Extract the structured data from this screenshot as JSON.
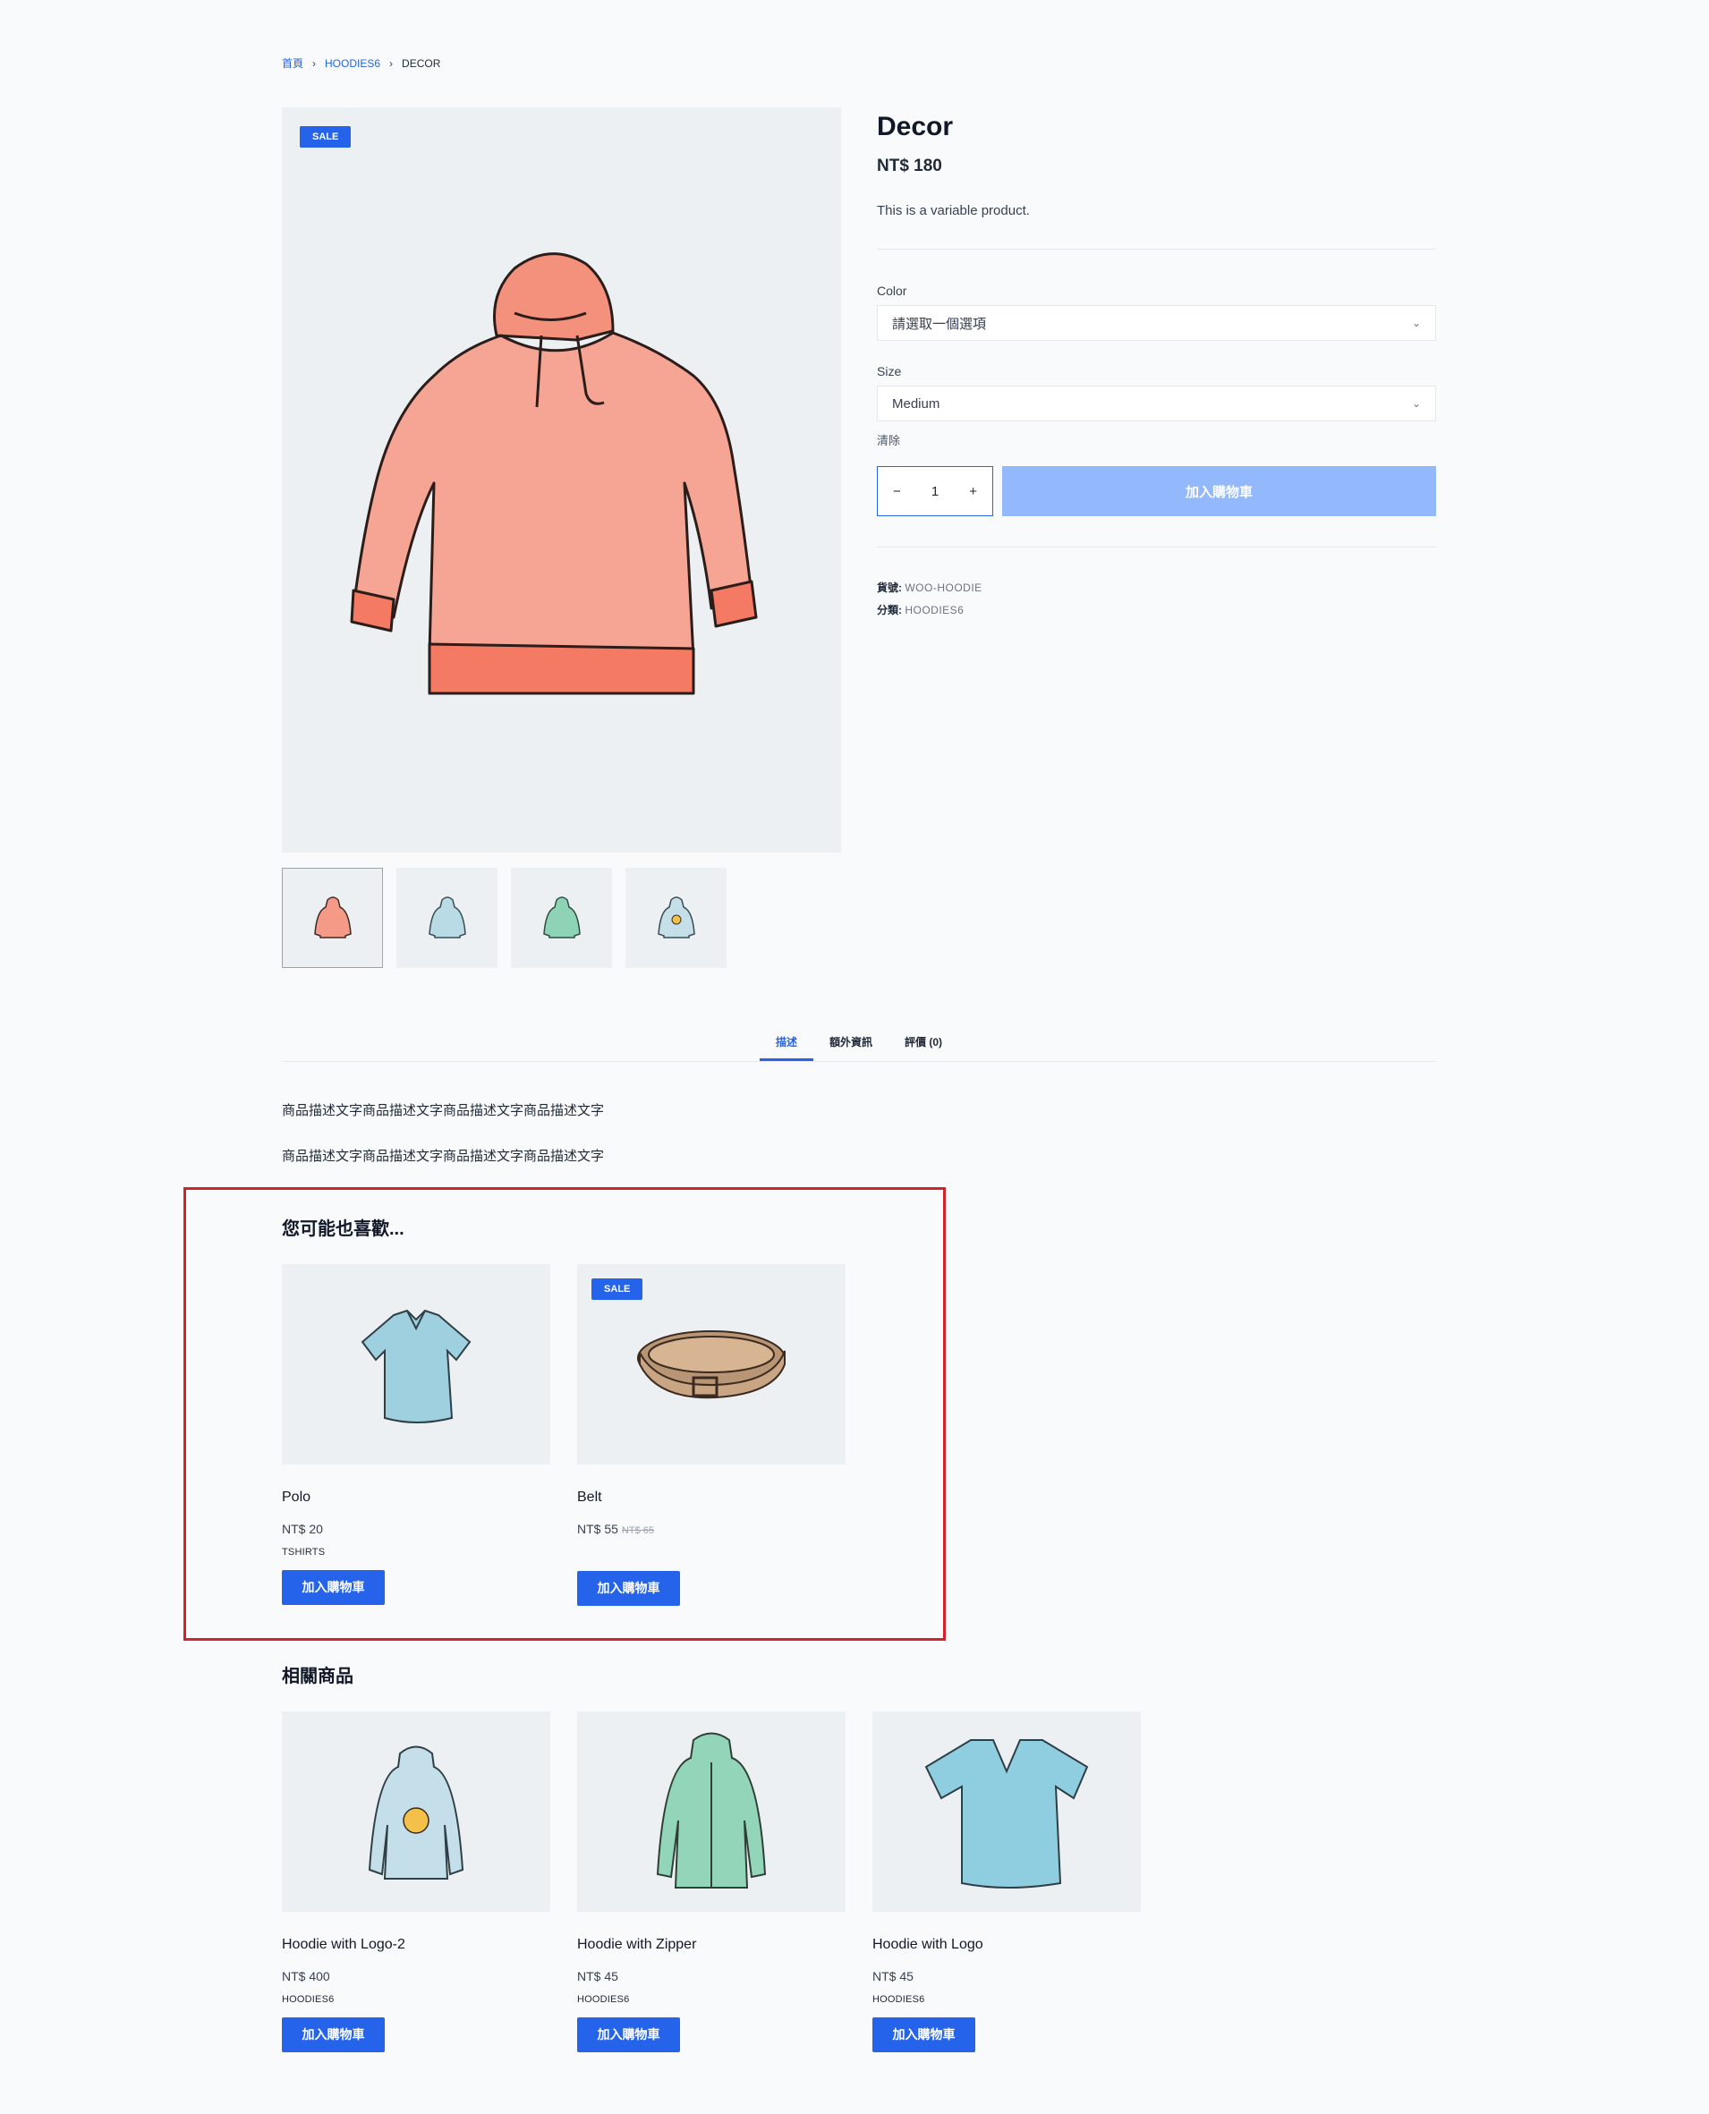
{
  "breadcrumb": {
    "home": "首頁",
    "category": "HOODIES6",
    "current": "DECOR"
  },
  "gallery": {
    "sale_badge": "SALE"
  },
  "product": {
    "title": "Decor",
    "price": "NT$ 180",
    "short_description": "This is a variable product.",
    "color_label": "Color",
    "color_value": "請選取一個選項",
    "size_label": "Size",
    "size_value": "Medium",
    "clear_label": "清除",
    "quantity": "1",
    "qty_minus": "−",
    "qty_plus": "+",
    "add_to_cart": "加入購物車",
    "sku_label": "貨號:",
    "sku_value": "WOO-HOODIE",
    "category_label": "分類:",
    "category_value": "HOODIES6"
  },
  "tabs": {
    "description": "描述",
    "additional": "額外資訊",
    "reviews": "評價 (0)"
  },
  "description": {
    "line1": "商品描述文字商品描述文字商品描述文字商品描述文字",
    "line2": "商品描述文字商品描述文字商品描述文字商品描述文字"
  },
  "upsells": {
    "title": "您可能也喜歡...",
    "items": [
      {
        "name": "Polo",
        "price": "NT$ 20",
        "old_price": "",
        "category": "TSHIRTS",
        "button": "加入購物車",
        "badge": ""
      },
      {
        "name": "Belt",
        "price": "NT$ 55",
        "old_price": "NT$ 65",
        "category": "",
        "button": "加入購物車",
        "badge": "SALE"
      }
    ]
  },
  "related": {
    "title": "相關商品",
    "items": [
      {
        "name": "Hoodie with Logo-2",
        "price": "NT$ 400",
        "category": "HOODIES6",
        "button": "加入購物車"
      },
      {
        "name": "Hoodie with Zipper",
        "price": "NT$ 45",
        "category": "HOODIES6",
        "button": "加入購物車"
      },
      {
        "name": "Hoodie with Logo",
        "price": "NT$ 45",
        "category": "HOODIES6",
        "button": "加入購物車"
      }
    ]
  },
  "colors": {
    "accent": "#2563eb",
    "button_disabled": "#93b8fb",
    "highlight": "#d2232a",
    "image_bg": "#ecf0f3"
  }
}
